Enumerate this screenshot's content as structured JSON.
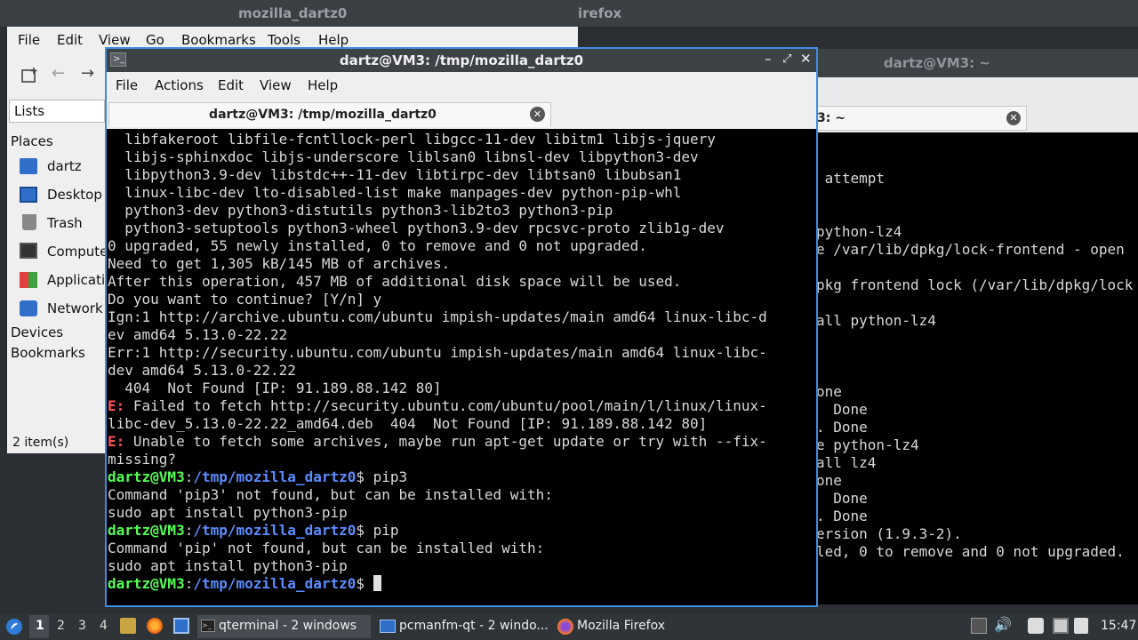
{
  "firefox": {
    "title": "irefox"
  },
  "back_terminal": {
    "title": "dartz@VM3: ~",
    "tab_title": "3: ~",
    "lines": [
      "",
      "",
      " attempt",
      "",
      "",
      "python-lz4",
      "e /var/lib/dpkg/lock-frontend - open",
      "",
      "pkg frontend lock (/var/lib/dpkg/lock",
      "",
      "all python-lz4",
      "",
      "",
      "",
      "one",
      "  Done",
      ". Done",
      "e python-lz4",
      "all lz4",
      "one",
      "  Done",
      ". Done",
      "ersion (1.9.3-2).",
      "led, 0 to remove and 0 not upgraded."
    ]
  },
  "file_manager": {
    "title": "mozilla_dartz0",
    "menu": [
      "File",
      "Edit",
      "View",
      "Go",
      "Bookmarks",
      "Tools",
      "Help"
    ],
    "lists_label": "Lists",
    "places_label": "Places",
    "places": [
      "dartz",
      "Desktop",
      "Trash",
      "Compute",
      "Applicati",
      "Network"
    ],
    "devices_label": "Devices",
    "bookmarks_label": "Bookmarks",
    "status": "2 item(s)"
  },
  "terminal": {
    "title": "dartz@VM3: /tmp/mozilla_dartz0",
    "menu": [
      "File",
      "Actions",
      "Edit",
      "View",
      "Help"
    ],
    "tab_title": "dartz@VM3: /tmp/mozilla_dartz0",
    "lines": [
      {
        "text": "  libfakeroot libfile-fcntllock-perl libgcc-11-dev libitm1 libjs-jquery"
      },
      {
        "text": "  libjs-sphinxdoc libjs-underscore liblsan0 libnsl-dev libpython3-dev"
      },
      {
        "text": "  libpython3.9-dev libstdc++-11-dev libtirpc-dev libtsan0 libubsan1"
      },
      {
        "text": "  linux-libc-dev lto-disabled-list make manpages-dev python-pip-whl"
      },
      {
        "text": "  python3-dev python3-distutils python3-lib2to3 python3-pip"
      },
      {
        "text": "  python3-setuptools python3-wheel python3.9-dev rpcsvc-proto zlib1g-dev"
      },
      {
        "text": "0 upgraded, 55 newly installed, 0 to remove and 0 not upgraded."
      },
      {
        "text": "Need to get 1,305 kB/145 MB of archives."
      },
      {
        "text": "After this operation, 457 MB of additional disk space will be used."
      },
      {
        "text": "Do you want to continue? [Y/n] y"
      },
      {
        "text": "Ign:1 http://archive.ubuntu.com/ubuntu impish-updates/main amd64 linux-libc-d"
      },
      {
        "text": "ev amd64 5.13.0-22.22"
      },
      {
        "text": "Err:1 http://security.ubuntu.com/ubuntu impish-updates/main amd64 linux-libc-"
      },
      {
        "text": "dev amd64 5.13.0-22.22"
      },
      {
        "text": "  404  Not Found [IP: 91.189.88.142 80]"
      },
      {
        "prefix": "E:",
        "text": " Failed to fetch http://security.ubuntu.com/ubuntu/pool/main/l/linux/linux-"
      },
      {
        "text": "libc-dev_5.13.0-22.22_amd64.deb  404  Not Found [IP: 91.189.88.142 80]"
      },
      {
        "prefix": "E:",
        "text": " Unable to fetch some archives, maybe run apt-get update or try with --fix-"
      },
      {
        "text": "missing?"
      },
      {
        "user": "dartz@VM3",
        "path": "/tmp/mozilla_dartz0",
        "text": "$ pip3"
      },
      {
        "text": "Command 'pip3' not found, but can be installed with:"
      },
      {
        "text": "sudo apt install python3-pip"
      },
      {
        "user": "dartz@VM3",
        "path": "/tmp/mozilla_dartz0",
        "text": "$ pip"
      },
      {
        "text": "Command 'pip' not found, but can be installed with:"
      },
      {
        "text": "sudo apt install python3-pip"
      },
      {
        "user": "dartz@VM3",
        "path": "/tmp/mozilla_dartz0",
        "text": "$ ",
        "cursor": true
      }
    ]
  },
  "taskbar": {
    "workspaces": [
      "1",
      "2",
      "3",
      "4"
    ],
    "tasks": [
      "qterminal - 2 windows",
      "pcmanfm-qt - 2 windo...",
      "Mozilla Firefox"
    ],
    "clock": "15:47"
  },
  "colors": {
    "accent": "#3d8ee0",
    "prompt_user": "#54ff54",
    "prompt_path": "#5b8cff",
    "error": "#ff5454"
  }
}
